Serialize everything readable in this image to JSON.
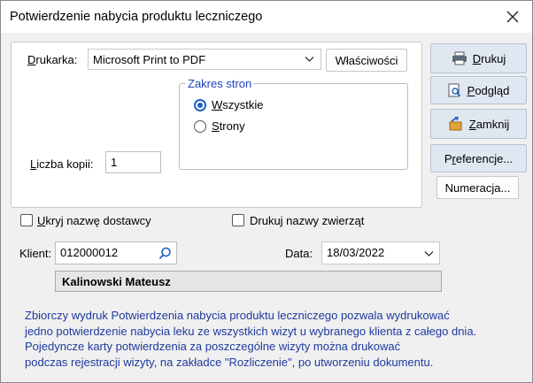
{
  "window": {
    "title": "Potwierdzenie nabycia produktu leczniczego"
  },
  "printer": {
    "label_pre": "D",
    "label_post": "rukarka:",
    "value": "Microsoft Print to PDF",
    "properties_button": "Właściwości"
  },
  "page_range": {
    "legend": "Zakres stron",
    "all_label_pre": "W",
    "all_label_post": "szystkie",
    "pages_label_pre": "S",
    "pages_label_post": "trony",
    "selected": "Wszystkie"
  },
  "copies": {
    "label_pre": "L",
    "label_post": "iczba kopii:",
    "value": "1"
  },
  "options": {
    "hide_supplier_pre": "U",
    "hide_supplier_post": "kryj nazwę dostawcy",
    "hide_supplier_checked": false,
    "print_animals_label": "Drukuj nazwy zwierząt",
    "print_animals_checked": false
  },
  "client": {
    "label": "Klient:",
    "code": "012000012",
    "name": "Kalinowski Mateusz"
  },
  "date": {
    "label": "Data:",
    "value": "18/03/2022"
  },
  "description": [
    "Zbiorczy wydruk Potwierdzenia nabycia produktu leczniczego pozwala wydrukować",
    "jedno potwierdzenie nabycia leku ze wszystkich wizyt u wybranego klienta z całego dnia.",
    "Pojedyncze karty potwierdzenia za poszczególne wizyty można drukować",
    "podczas rejestracji wizyty, na zakładce \"Rozliczenie\", po utworzeniu dokumentu."
  ],
  "actions": {
    "print_pre": "D",
    "print_post": "rukuj",
    "preview_pre": "P",
    "preview_post": "odgląd",
    "close_pre": "Z",
    "close_post": "amknij",
    "preferences_pre": "P",
    "preferences_mid": "r",
    "preferences_post": "eferencje...",
    "numbering": "Numeracja..."
  },
  "icons": [
    "close-icon",
    "chevron-down-icon",
    "search-icon",
    "printer-icon",
    "preview-icon",
    "close-door-icon"
  ]
}
